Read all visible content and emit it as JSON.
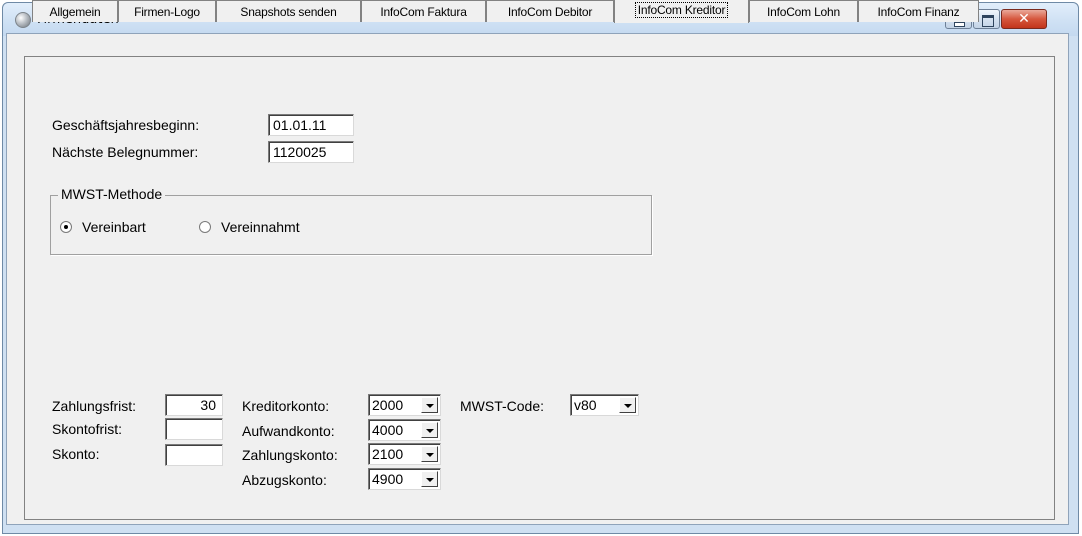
{
  "window": {
    "title": "Firmendaten",
    "close_glyph": "✕"
  },
  "tabs": [
    {
      "label": "Allgemein",
      "active": false
    },
    {
      "label": "Firmen-Logo",
      "active": false
    },
    {
      "label": "Snapshots senden",
      "active": false
    },
    {
      "label": "InfoCom Faktura",
      "active": false
    },
    {
      "label": "InfoCom Debitor",
      "active": false
    },
    {
      "label": "InfoCom Kreditor",
      "active": true
    },
    {
      "label": "InfoCom Lohn",
      "active": false
    },
    {
      "label": "InfoCom Finanz",
      "active": false
    }
  ],
  "fields": {
    "geschaeftsjahresbeginn": {
      "label": "Geschäftsjahresbeginn:",
      "value": "01.01.11"
    },
    "naechste_belegnummer": {
      "label": "Nächste Belegnummer:",
      "value": "1120025"
    }
  },
  "mwst_methode": {
    "legend": "MWST-Methode",
    "options": [
      {
        "label": "Vereinbart",
        "checked": true
      },
      {
        "label": "Vereinnahmt",
        "checked": false
      }
    ]
  },
  "payment": {
    "zahlungsfrist": {
      "label": "Zahlungsfrist:",
      "value": "30"
    },
    "skontofrist": {
      "label": "Skontofrist:",
      "value": ""
    },
    "skonto": {
      "label": "Skonto:",
      "value": ""
    }
  },
  "accounts": {
    "kreditorkonto": {
      "label": "Kreditorkonto:",
      "value": "2000"
    },
    "aufwandkonto": {
      "label": "Aufwandkonto:",
      "value": "4000"
    },
    "zahlungskonto": {
      "label": "Zahlungskonto:",
      "value": "2100"
    },
    "abzugskonto": {
      "label": "Abzugskonto:",
      "value": "4900"
    }
  },
  "mwst_code": {
    "label": "MWST-Code:",
    "value": "v80"
  },
  "icons": {
    "app": "app-globe-icon",
    "minimize": "minimize-icon",
    "maximize": "maximize-icon",
    "close": "close-icon",
    "dropdown": "chevron-down-icon"
  },
  "colors": {
    "window_frame": "#cfe0f2",
    "client_bg": "#f0f0f0",
    "close_button": "#c2351b"
  }
}
